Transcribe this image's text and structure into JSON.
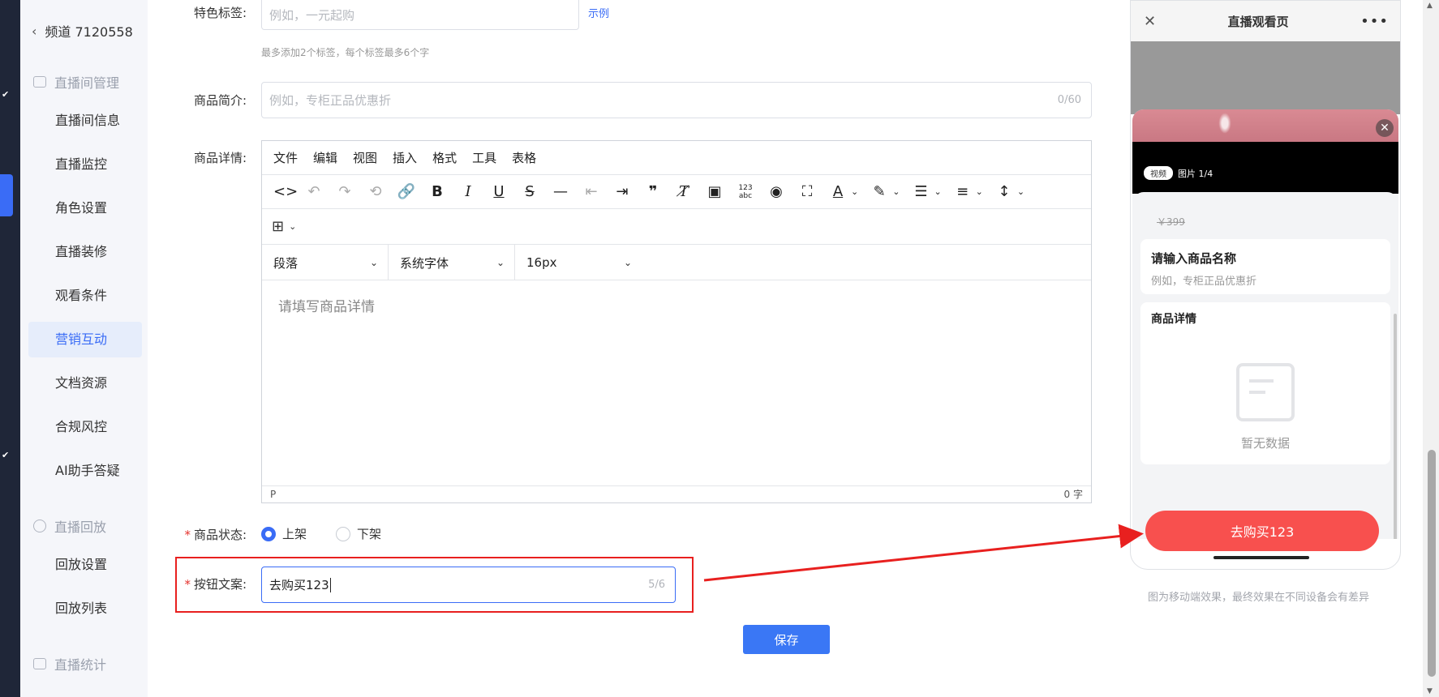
{
  "sidebar": {
    "back_label": "频道 7120558",
    "groups": {
      "live_manage": "直播间管理",
      "playback": "直播回放",
      "stats": "直播统计"
    },
    "items": [
      {
        "label": "直播间信息"
      },
      {
        "label": "直播监控"
      },
      {
        "label": "角色设置"
      },
      {
        "label": "直播装修"
      },
      {
        "label": "观看条件"
      },
      {
        "label": "营销互动",
        "active": true
      },
      {
        "label": "文档资源"
      },
      {
        "label": "合规风控"
      },
      {
        "label": "AI助手答疑"
      },
      {
        "label": "回放设置"
      },
      {
        "label": "回放列表"
      }
    ]
  },
  "form": {
    "feature_tags": {
      "label": "特色标签:",
      "placeholder": "例如，一元起购",
      "example_link": "示例",
      "hint": "最多添加2个标签，每个标签最多6个字"
    },
    "intro": {
      "label": "商品简介:",
      "placeholder": "例如，专柜正品优惠折",
      "counter": "0/60"
    },
    "detail": {
      "label": "商品详情:",
      "menu": [
        "文件",
        "编辑",
        "视图",
        "插入",
        "格式",
        "工具",
        "表格"
      ],
      "block_format": "段落",
      "font_family": "系统字体",
      "font_size": "16px",
      "placeholder": "请填写商品详情",
      "status_path": "P",
      "word_count": "0 字"
    },
    "status": {
      "label": "商品状态:",
      "options": [
        "上架",
        "下架"
      ],
      "selected": "上架"
    },
    "button_text": {
      "label": "按钮文案:",
      "value": "去购买123",
      "counter": "5/6"
    },
    "save_label": "保存"
  },
  "preview": {
    "title": "直播观看页",
    "media_tag": "视频",
    "image_count": "图片 1/4",
    "price": "￥399",
    "name_placeholder": "请输入商品名称",
    "intro_placeholder": "例如，专柜正品优惠折",
    "detail_title": "商品详情",
    "empty_text": "暂无数据",
    "buy_button": "去购买123",
    "note": "图为移动端效果，最终效果在不同设备会有差异"
  },
  "colors": {
    "primary": "#3a6cf6",
    "buy_button": "#f8504e",
    "highlight": "#e8201f"
  }
}
